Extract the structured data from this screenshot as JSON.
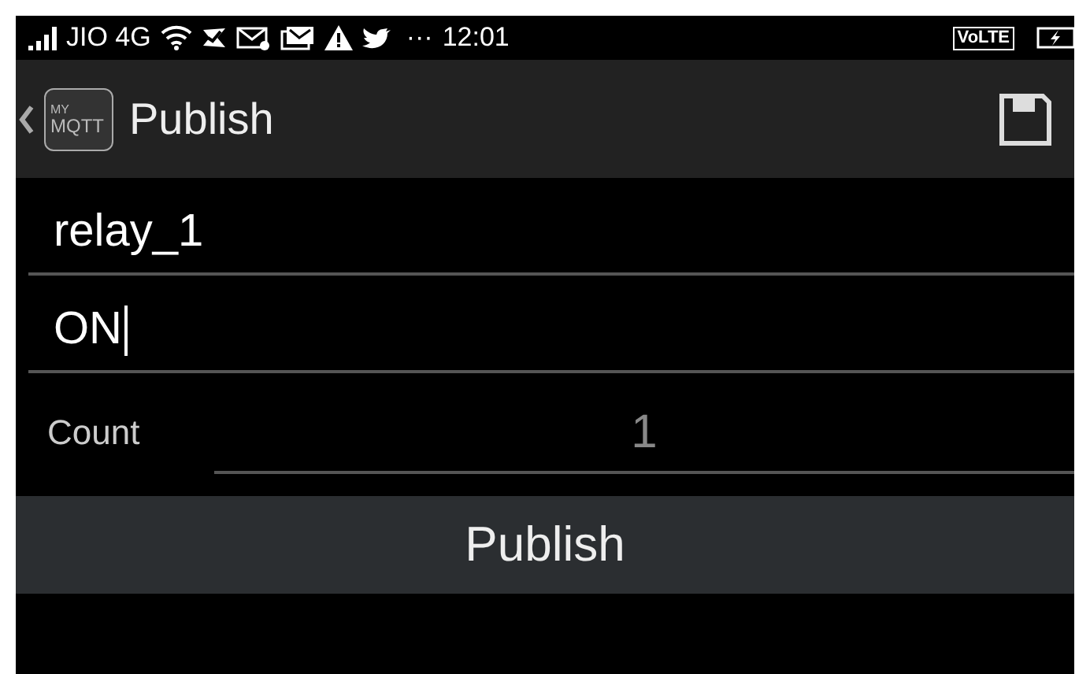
{
  "status_bar": {
    "carrier": "JIO 4G",
    "more": "···",
    "time": "12:01",
    "volte": "VoLTE"
  },
  "action_bar": {
    "logo_top": "MY",
    "logo_bottom": "MQTT",
    "title": "Publish"
  },
  "fields": [
    {
      "value": "relay_1",
      "focused": false
    },
    {
      "value": "ON",
      "focused": true
    }
  ],
  "count": {
    "label": "Count",
    "value": "1"
  },
  "button": "Publish"
}
